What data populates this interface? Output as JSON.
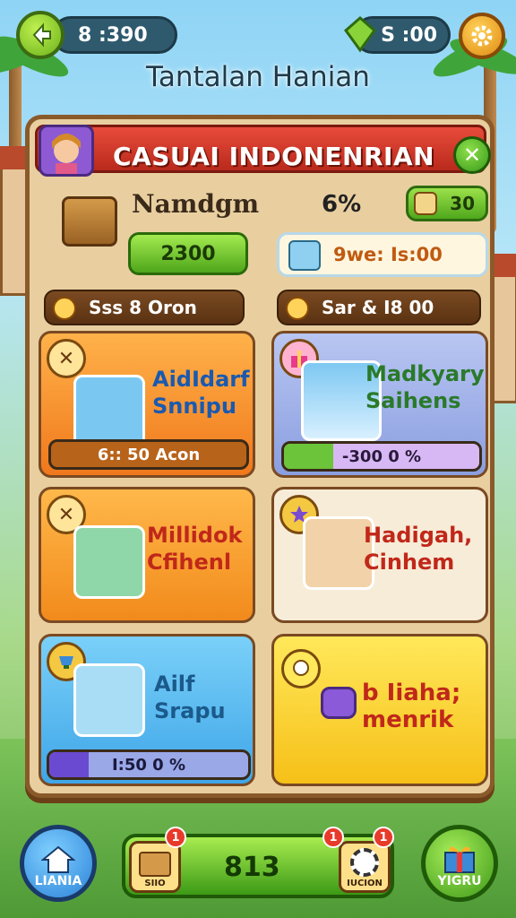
{
  "top_bar": {
    "coins": "8 :390",
    "gems": "S :00"
  },
  "screen_title": "Tantalan Hanian",
  "panel": {
    "title": "CASUAI INDONENRIAN",
    "player_name": "Namdgm",
    "percent": "6%",
    "reward_value": "30",
    "main_button": "2300",
    "timer": "9we: Is:00"
  },
  "tabs": [
    {
      "label": "Sss 8 Oron"
    },
    {
      "label": "Sar & I8 00"
    }
  ],
  "cards": [
    {
      "title_line1": "AidIdarf",
      "title_line2": "Snnipu",
      "bar": "6:: 50 Acon",
      "badge": "✕"
    },
    {
      "title_line1": "Madkyary",
      "title_line2": "Saihens",
      "bar": "-300 0 %",
      "progress": 0.25
    },
    {
      "title_line1": "Millidok",
      "title_line2": "Cfihenl",
      "badge": "✕"
    },
    {
      "title_line1": "Hadigah,",
      "title_line2": "Cinhem"
    },
    {
      "title_line1": "Ailf",
      "title_line2": "Srapu",
      "bar": "I:50 0 %",
      "progress": 0.2
    },
    {
      "title_line1": "b Iiaha;",
      "title_line2": "menrik"
    }
  ],
  "bottom_nav": {
    "home_label": "LIANIA",
    "center_value": "813",
    "slot_left_label": "SIIO",
    "slot_right_label": "IUCION",
    "gift_label": "YIGRU",
    "notif_count": "1"
  },
  "colors": {
    "accent_green": "#4fa81c",
    "header_red": "#e84b3a",
    "panel_bg": "#e9cfa0"
  }
}
